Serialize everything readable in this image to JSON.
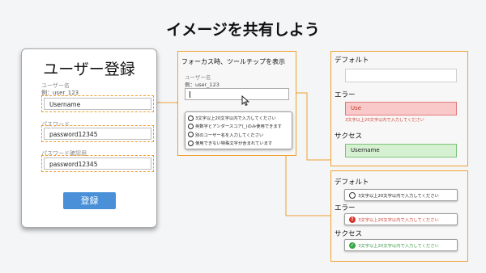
{
  "title": "イメージを共有しよう",
  "colors": {
    "accent": "#f0a030",
    "button": "#4a90d9",
    "error": "#d0443a",
    "success": "#3a9a47"
  },
  "registration": {
    "title": "ユーザー登録",
    "username": {
      "label": "ユーザー名",
      "example": "例：user_123",
      "value": "Username"
    },
    "password": {
      "label": "パスワード",
      "value": "password12345"
    },
    "password_confirm": {
      "label": "パスワード確認用",
      "value": "password12345"
    },
    "submit_label": "登録"
  },
  "focus_panel": {
    "title": "フォーカス時、ツールチップを表示",
    "label": "ユーザー名",
    "example": "例：user_123",
    "input_value": "",
    "tooltip_items": [
      "3文字以上20文字以内で入力してください",
      "英数字とアンダースコア(_)のみ使用できます",
      "別のユーザー名を入力してください",
      "使用できない特殊文字が含まれています"
    ]
  },
  "states_inline": {
    "default_label": "デフォルト",
    "default_value": "",
    "error_label": "エラー",
    "error_value": "Use",
    "error_message": "3文字以上20文字以内で入力してください",
    "success_label": "サクセス",
    "success_value": "Username"
  },
  "states_tooltip": {
    "default_label": "デフォルト",
    "default_message": "3文字以上20文字以内で入力してください",
    "error_label": "エラー",
    "error_message": "3文字以上20文字以内で入力してください",
    "success_label": "サクセス",
    "success_message": "3文字以上20文字以内で入力してください"
  }
}
